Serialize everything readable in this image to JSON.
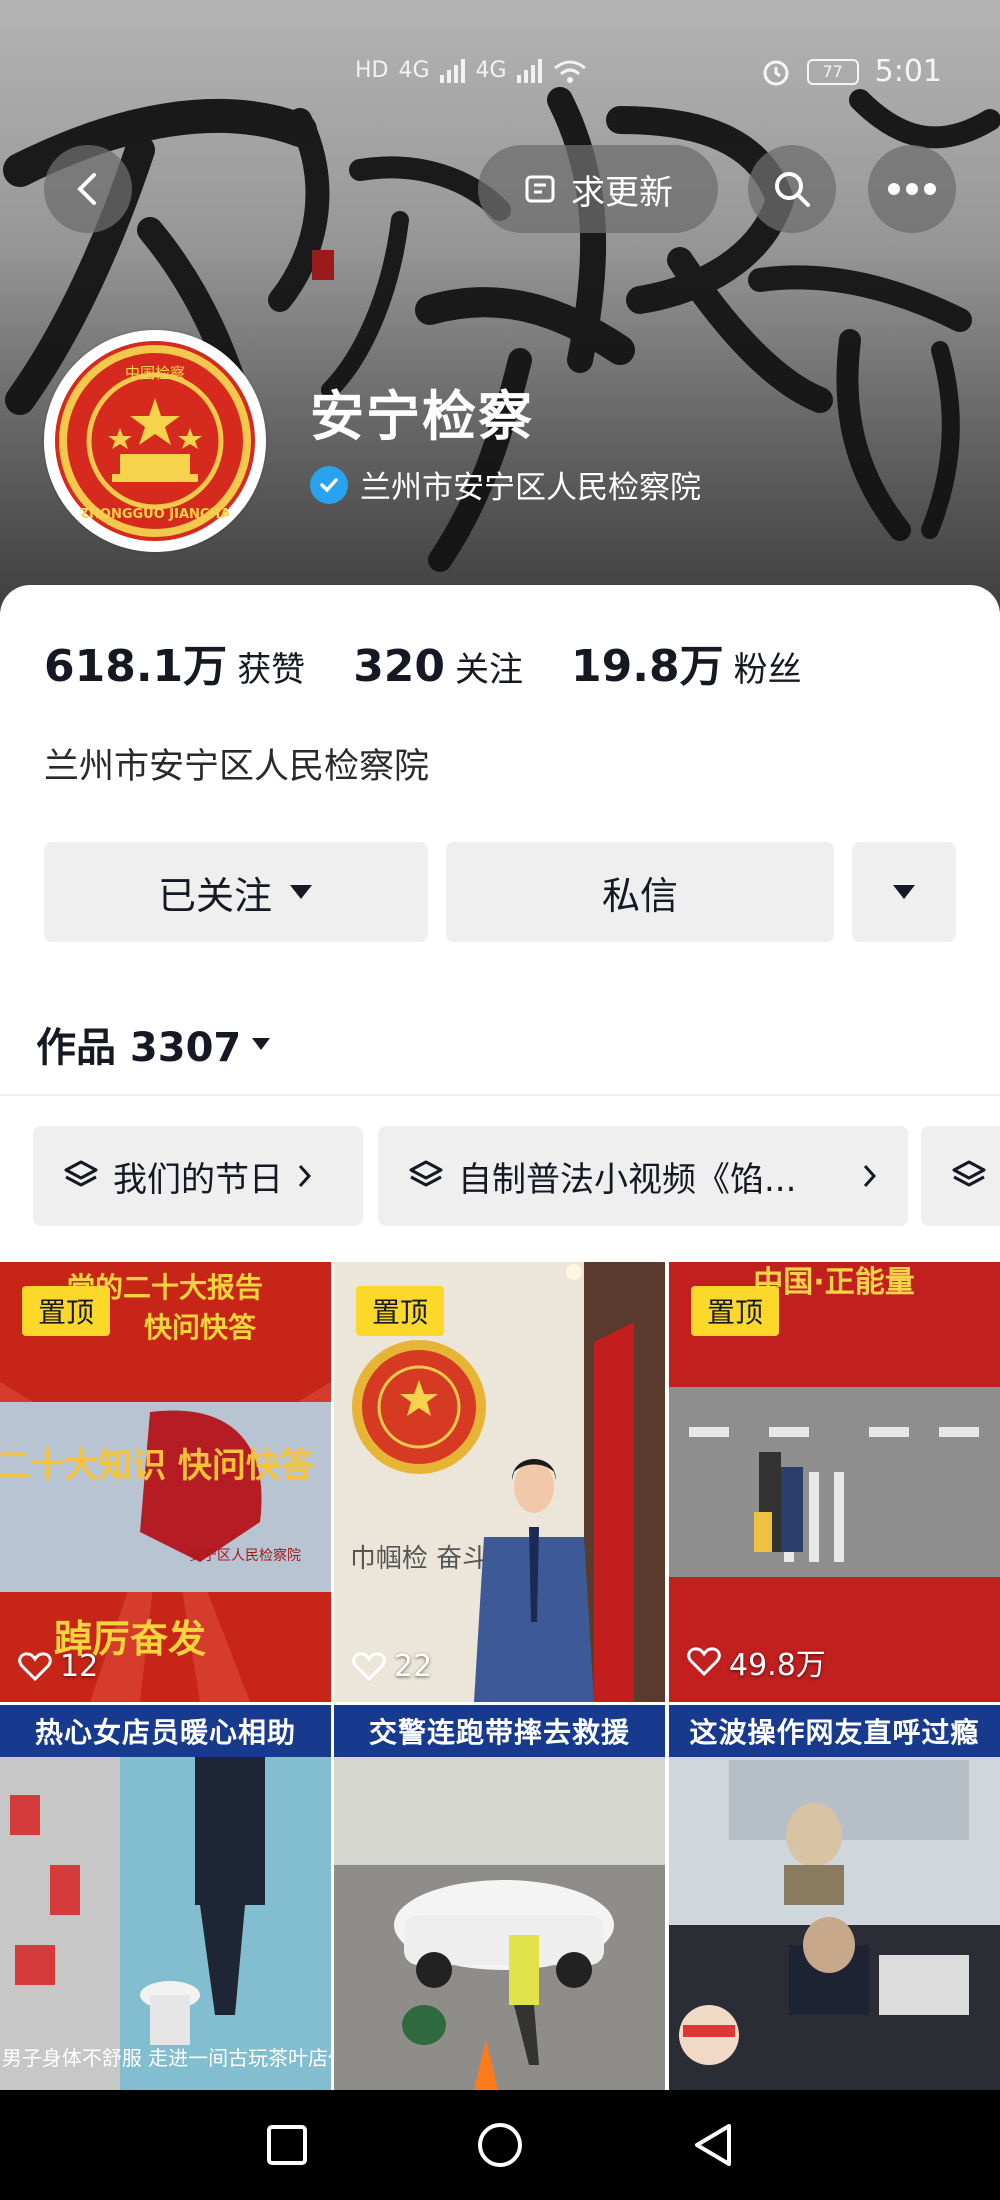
{
  "status_bar": {
    "network_label": "HD",
    "signal_1": "4G",
    "signal_2": "4G",
    "battery": "77",
    "time": "5:01"
  },
  "header": {
    "back_icon": "chevron-left-icon",
    "update_label": "求更新",
    "search_icon": "search-icon",
    "more_icon": "more-horizontal-icon",
    "seal_text": "ZHONGGUO JIANCHA",
    "seal_top_text": "中国检察"
  },
  "profile": {
    "name": "安宁检察",
    "verified_label": "兰州市安宁区人民检察院",
    "verified_color": "#29a3ef"
  },
  "stats": [
    {
      "value": "618.1万",
      "label": "获赞"
    },
    {
      "value": "320",
      "label": "关注"
    },
    {
      "value": "19.8万",
      "label": "粉丝"
    }
  ],
  "bio": "兰州市安宁区人民检察院",
  "actions": {
    "follow_label": "已关注",
    "message_label": "私信"
  },
  "works": {
    "label": "作品 3307"
  },
  "collections": [
    {
      "label": "我们的节日"
    },
    {
      "label": "自制普法小视频《馅..."
    }
  ],
  "videos": [
    {
      "pinned": "置顶",
      "likes": "12",
      "title_top": "党的二十大报告",
      "title_sub": "快问快答",
      "center": "二十大知识 快问快答",
      "org": "安宁区人民检察院",
      "bottom": "踔厉奋发"
    },
    {
      "pinned": "置顶",
      "likes": "22",
      "vertical": "巾帼检 奋斗"
    },
    {
      "pinned": "置顶",
      "likes": "49.8万",
      "title_top": "中国·正能量"
    },
    {
      "caption": "热心女店员暖心相助",
      "bottom_text": "一名男子身体不舒服 走进一间古玩茶叶店休息"
    },
    {
      "caption": "交警连跑带摔去救援"
    },
    {
      "caption": "这波操作网友直呼过瘾"
    }
  ],
  "colors": {
    "accent_yellow": "#fcd82b",
    "text_dark": "#161823",
    "button_gray": "#efefef"
  }
}
